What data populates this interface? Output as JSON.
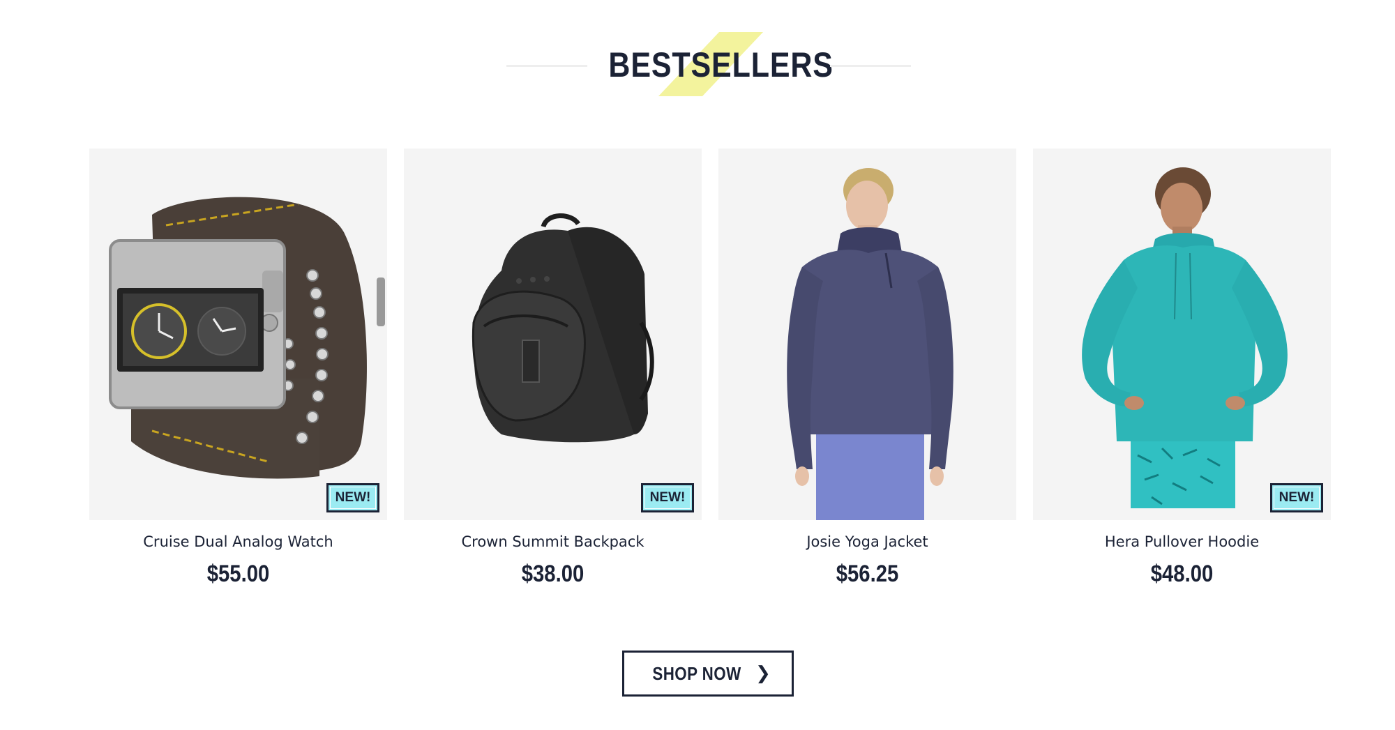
{
  "section": {
    "title": "BESTSELLERS",
    "accent_color": "#f2f292"
  },
  "products": [
    {
      "name": "Cruise Dual Analog Watch",
      "price": "$55.00",
      "badge": "NEW!",
      "icon": "watch-image"
    },
    {
      "name": "Crown Summit Backpack",
      "price": "$38.00",
      "badge": "NEW!",
      "icon": "backpack-image"
    },
    {
      "name": "Josie Yoga Jacket",
      "price": "$56.25",
      "badge": "",
      "icon": "jacket-image"
    },
    {
      "name": "Hera Pullover Hoodie",
      "price": "$48.00",
      "badge": "NEW!",
      "icon": "hoodie-image"
    }
  ],
  "cta": {
    "label": "SHOP NOW",
    "icon": "chevron-right-icon"
  },
  "colors": {
    "text": "#1b2235",
    "badge_bg": "#9bebf2",
    "card_bg": "#f4f4f4"
  }
}
